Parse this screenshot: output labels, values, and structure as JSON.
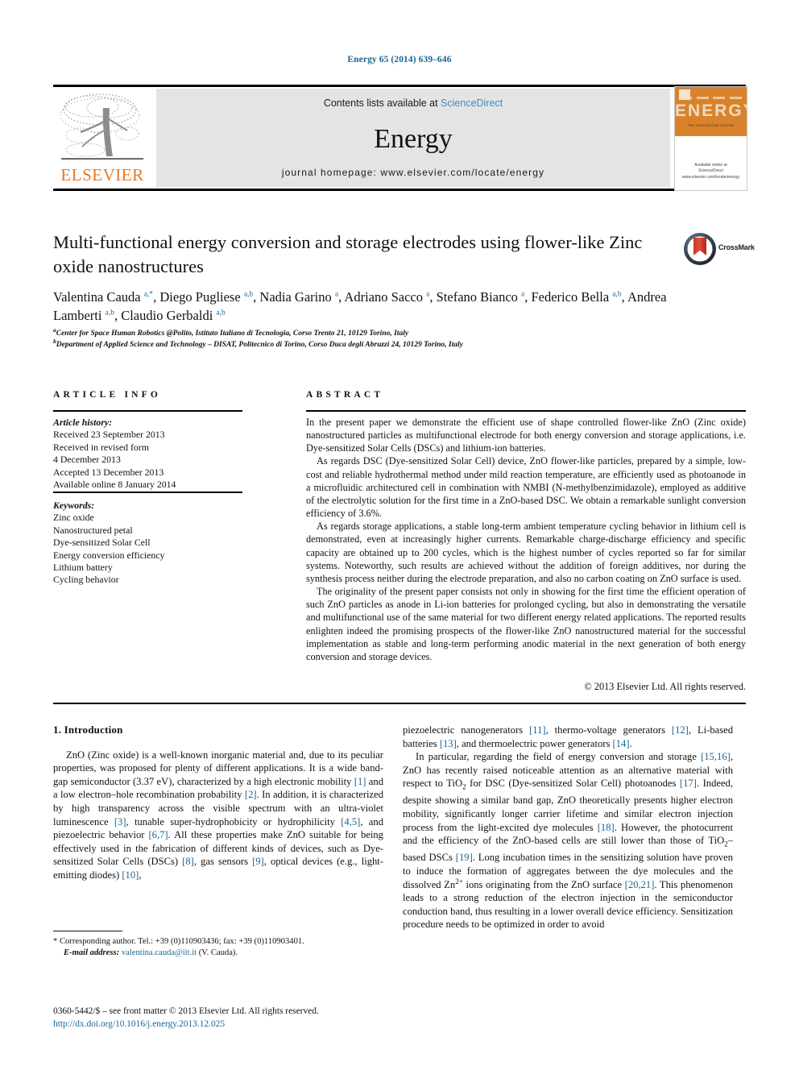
{
  "running_head": "Energy 65 (2014) 639–646",
  "masthead": {
    "publisher": "ELSEVIER",
    "contents_prefix": "Contents lists available at ",
    "contents_link": "ScienceDirect",
    "journal_name": "Energy",
    "homepage": "journal homepage: www.elsevier.com/locate/energy",
    "cover": {
      "title": "ENERGY",
      "subtitle": "The International Journal",
      "footer_line1": "Available online at",
      "footer_line2": "ScienceDirect",
      "footer_line3": "www.elsevier.com/locate/energy"
    }
  },
  "article": {
    "title": "Multi-functional energy conversion and storage electrodes using flower-like Zinc oxide nanostructures",
    "crossmark_label": "CrossMark",
    "authors_html": "Valentina Cauda <sup>a,*</sup>, Diego Pugliese <sup>a,b</sup>, Nadia Garino <sup>a</sup>, Adriano Sacco <sup>a</sup>, Stefano Bianco <sup>a</sup>, Federico Bella <sup>a,b</sup>, Andrea Lamberti <sup>a,b</sup>, Claudio Gerbaldi <sup>a,b</sup>",
    "affiliation_a": "Center for Space Human Robotics @Polito, Istituto Italiano di Tecnologia, Corso Trento 21, 10129 Torino, Italy",
    "affiliation_b": "Department of Applied Science and Technology – DISAT, Politecnico di Torino, Corso Duca degli Abruzzi 24, 10129 Torino, Italy"
  },
  "info": {
    "heading": "ARTICLE INFO",
    "history_label": "Article history:",
    "history": [
      "Received 23 September 2013",
      "Received in revised form",
      "4 December 2013",
      "Accepted 13 December 2013",
      "Available online 8 January 2014"
    ],
    "keywords_label": "Keywords:",
    "keywords": [
      "Zinc oxide",
      "Nanostructured petal",
      "Dye-sensitized Solar Cell",
      "Energy conversion efficiency",
      "Lithium battery",
      "Cycling behavior"
    ]
  },
  "abstract": {
    "heading": "ABSTRACT",
    "paragraphs": [
      "In the present paper we demonstrate the efficient use of shape controlled flower-like ZnO (Zinc oxide) nanostructured particles as multifunctional electrode for both energy conversion and storage applications, i.e. Dye-sensitized Solar Cells (DSCs) and lithium-ion batteries.",
      "As regards DSC (Dye-sensitized Solar Cell) device, ZnO flower-like particles, prepared by a simple, low-cost and reliable hydrothermal method under mild reaction temperature, are efficiently used as photoanode in a microfluidic architectured cell in combination with NMBI (N-methylbenzimidazole), employed as additive of the electrolytic solution for the first time in a ZnO-based DSC. We obtain a remarkable sunlight conversion efficiency of 3.6%.",
      "As regards storage applications, a stable long-term ambient temperature cycling behavior in lithium cell is demonstrated, even at increasingly higher currents. Remarkable charge-discharge efficiency and specific capacity are obtained up to 200 cycles, which is the highest number of cycles reported so far for similar systems. Noteworthy, such results are achieved without the addition of foreign additives, nor during the synthesis process neither during the electrode preparation, and also no carbon coating on ZnO surface is used.",
      "The originality of the present paper consists not only in showing for the first time the efficient operation of such ZnO particles as anode in Li-ion batteries for prolonged cycling, but also in demonstrating the versatile and multifunctional use of the same material for two different energy related applications. The reported results enlighten indeed the promising prospects of the flower-like ZnO nanostructured material for the successful implementation as stable and long-term performing anodic material in the next generation of both energy conversion and storage devices."
    ],
    "copyright": "© 2013 Elsevier Ltd. All rights reserved."
  },
  "body": {
    "section_heading": "1. Introduction",
    "left_html": "ZnO (Zinc oxide) is a well-known inorganic material and, due to its peculiar properties, was proposed for plenty of different applications. It is a wide band-gap semiconductor (3.37 eV), characterized by a high electronic mobility <span class=\"ref\">[1]</span> and a low electron–hole recombination probability <span class=\"ref\">[2]</span>. In addition, it is characterized by high transparency across the visible spectrum with an ultra-violet luminescence <span class=\"ref\">[3]</span>, tunable super-hydrophobicity or hydrophilicity <span class=\"ref\">[4,5]</span>, and piezoelectric behavior <span class=\"ref\">[6,7]</span>. All these properties make ZnO suitable for being effectively used in the fabrication of different kinds of devices, such as Dye-sensitized Solar Cells (DSCs) <span class=\"ref\">[8]</span>, gas sensors <span class=\"ref\">[9]</span>, optical devices (e.g., light-emitting diodes) <span class=\"ref\">[10]</span>,",
    "right_html_1": "piezoelectric nanogenerators <span class=\"ref\">[11]</span>, thermo-voltage generators <span class=\"ref\">[12]</span>, Li-based batteries <span class=\"ref\">[13]</span>, and thermoelectric power generators <span class=\"ref\">[14]</span>.",
    "right_html_2": "In particular, regarding the field of energy conversion and storage <span class=\"ref\">[15,16]</span>, ZnO has recently raised noticeable attention as an alternative material with respect to TiO<sub>2</sub> for DSC (Dye-sensitized Solar Cell) photoanodes <span class=\"ref\">[17]</span>. Indeed, despite showing a similar band gap, ZnO theoretically presents higher electron mobility, significantly longer carrier lifetime and similar electron injection process from the light-excited dye molecules <span class=\"ref\">[18]</span>. However, the photocurrent and the efficiency of the ZnO-based cells are still lower than those of TiO<sub>2</sub>–based DSCs <span class=\"ref\">[19]</span>. Long incubation times in the sensitizing solution have proven to induce the formation of aggregates between the dye molecules and the dissolved Zn<sup class=\"inl\">2+</sup> ions originating from the ZnO surface <span class=\"ref\">[20,21]</span>. This phenomenon leads to a strong reduction of the electron injection in the semiconductor conduction band, thus resulting in a lower overall device efficiency. Sensitization procedure needs to be optimized in order to avoid"
  },
  "footnotes": {
    "corresponding_html": "* Corresponding author. Tel.: +39 (0)110903436; fax: +39 (0)110903401.",
    "email_label": "E-mail address:",
    "email": "valentina.cauda@iit.it",
    "email_suffix": " (V. Cauda)."
  },
  "imprint": {
    "issn_line": "0360-5442/$ – see front matter © 2013 Elsevier Ltd. All rights reserved.",
    "doi": "http://dx.doi.org/10.1016/j.energy.2013.12.025"
  },
  "colors": {
    "link": "#1a6496",
    "elsevier_orange": "#E87722",
    "panel_gray": "#e4e4e4",
    "cover_orange": "#D8832B"
  }
}
